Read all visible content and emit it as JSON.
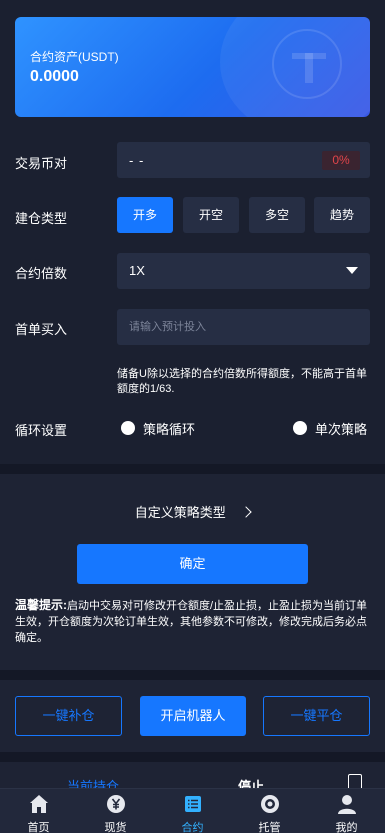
{
  "asset": {
    "label": "合约资产(USDT)",
    "value": "0.0000"
  },
  "form": {
    "pair": {
      "label": "交易币对",
      "value": "- -",
      "percent": "0%"
    },
    "build_type": {
      "label": "建仓类型",
      "options": [
        "开多",
        "开空",
        "多空",
        "趋势"
      ],
      "selected": "开多"
    },
    "multiplier": {
      "label": "合约倍数",
      "value": "1X"
    },
    "first_buy": {
      "label": "首单买入",
      "placeholder": "请输入预计投入"
    },
    "note": "储备U除以选择的合约倍数所得额度，不能高于首单额度的1/63.",
    "loop": {
      "label": "循环设置",
      "options": [
        "策略循环",
        "单次策略"
      ]
    }
  },
  "custom_strategy": {
    "label": "自定义策略类型"
  },
  "confirm": {
    "label": "确定"
  },
  "tip": {
    "title": "温馨提示:",
    "text": "启动中交易对可修改开仓额度/止盈止损，止盈止损为当前订单生效，开仓额度为次轮订单生效，其他参数不可修改，修改完成后务必点确定。"
  },
  "actions": {
    "replenish": "一键补仓",
    "start_robot": "开启机器人",
    "close_all": "一键平仓"
  },
  "peek": {
    "tab_current": "当前持仓",
    "tab_stop": "停止"
  },
  "tabbar": {
    "items": [
      {
        "label": "首页",
        "icon": "home-icon"
      },
      {
        "label": "现货",
        "icon": "yen-coin-icon"
      },
      {
        "label": "合约",
        "icon": "contract-list-icon"
      },
      {
        "label": "托管",
        "icon": "custody-icon"
      },
      {
        "label": "我的",
        "icon": "user-icon"
      }
    ],
    "active": "合约"
  },
  "colors": {
    "accent": "#1677ff",
    "background": "#1b2030",
    "field": "#262e44",
    "danger": "#e0454a",
    "active_tab": "#33b1ff"
  }
}
